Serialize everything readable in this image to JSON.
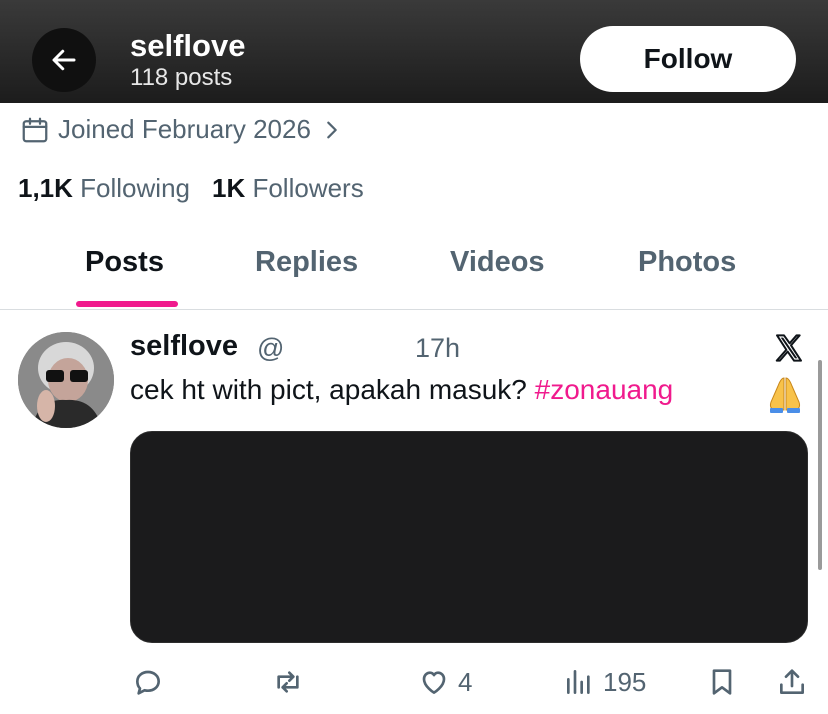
{
  "header": {
    "name": "selflove",
    "post_count": "118 posts",
    "follow_label": "Follow"
  },
  "profile": {
    "joined": "Joined February 2026",
    "following_count": "1,1K",
    "following_label": "Following",
    "followers_count": "1K",
    "followers_label": "Followers"
  },
  "tabs": [
    {
      "label": "Posts",
      "active": true
    },
    {
      "label": "Replies",
      "active": false
    },
    {
      "label": "Videos",
      "active": false
    },
    {
      "label": "Photos",
      "active": false
    }
  ],
  "post": {
    "name": "selflove",
    "handle": "@",
    "time": "17h",
    "text": "cek ht with pict, apakah masuk?",
    "hashtag": "#zonauang",
    "emoji": "🙏",
    "actions": {
      "reply_count": "",
      "repost_count": "",
      "like_count": "4",
      "views_count": "195"
    }
  },
  "colors": {
    "accent": "#f01a8d",
    "muted": "#536471",
    "text": "#0f1419"
  }
}
